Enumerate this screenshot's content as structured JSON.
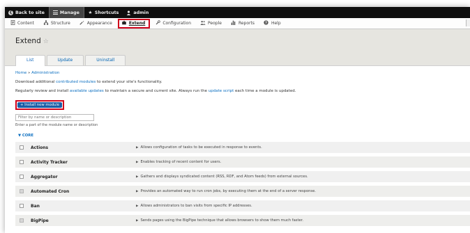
{
  "toolbar": {
    "back_label": "Back to site",
    "manage_label": "Manage",
    "shortcuts_label": "Shortcuts",
    "user_label": "admin"
  },
  "tray": {
    "items": [
      {
        "label": "Content",
        "icon": "content-icon"
      },
      {
        "label": "Structure",
        "icon": "structure-icon"
      },
      {
        "label": "Appearance",
        "icon": "appearance-icon"
      },
      {
        "label": "Extend",
        "icon": "puzzle-icon"
      },
      {
        "label": "Configuration",
        "icon": "wrench-icon"
      },
      {
        "label": "People",
        "icon": "people-icon"
      },
      {
        "label": "Reports",
        "icon": "reports-icon"
      },
      {
        "label": "Help",
        "icon": "help-icon"
      }
    ]
  },
  "page": {
    "title": "Extend",
    "tabs": [
      "List",
      "Update",
      "Uninstall"
    ]
  },
  "breadcrumb": {
    "home": "Home",
    "sep": "»",
    "admin": "Administration"
  },
  "intro": {
    "p1_a": "Download additional ",
    "p1_link": "contributed modules",
    "p1_b": " to extend your site's functionality.",
    "p2_a": "Regularly review and install ",
    "p2_link1": "available updates",
    "p2_b": " to maintain a secure and current site. Always run the ",
    "p2_link2": "update script",
    "p2_c": " each time a module is updated."
  },
  "install_button": "+ Install new module",
  "filter": {
    "placeholder": "Filter by name or description",
    "description": "Enter a part of the module name or description"
  },
  "core_label": "▼ CORE",
  "modules": [
    {
      "name": "Actions",
      "desc": "Allows configuration of tasks to be executed in response to events."
    },
    {
      "name": "Activity Tracker",
      "desc": "Enables tracking of recent content for users."
    },
    {
      "name": "Aggregator",
      "desc": "Gathers and displays syndicated content (RSS, RDF, and Atom feeds) from external sources."
    },
    {
      "name": "Automated Cron",
      "desc": "Provides an automated way to run cron jobs, by executing them at the end of a server response."
    },
    {
      "name": "Ban",
      "desc": "Allows administrators to ban visits from specific IP addresses."
    },
    {
      "name": "BigPipe",
      "desc": "Sends pages using the BigPipe technique that allows browsers to show them much faster."
    }
  ],
  "colors": {
    "highlight": "#d0021b",
    "link": "#0a6ec0",
    "button": "#1a5ea7"
  }
}
